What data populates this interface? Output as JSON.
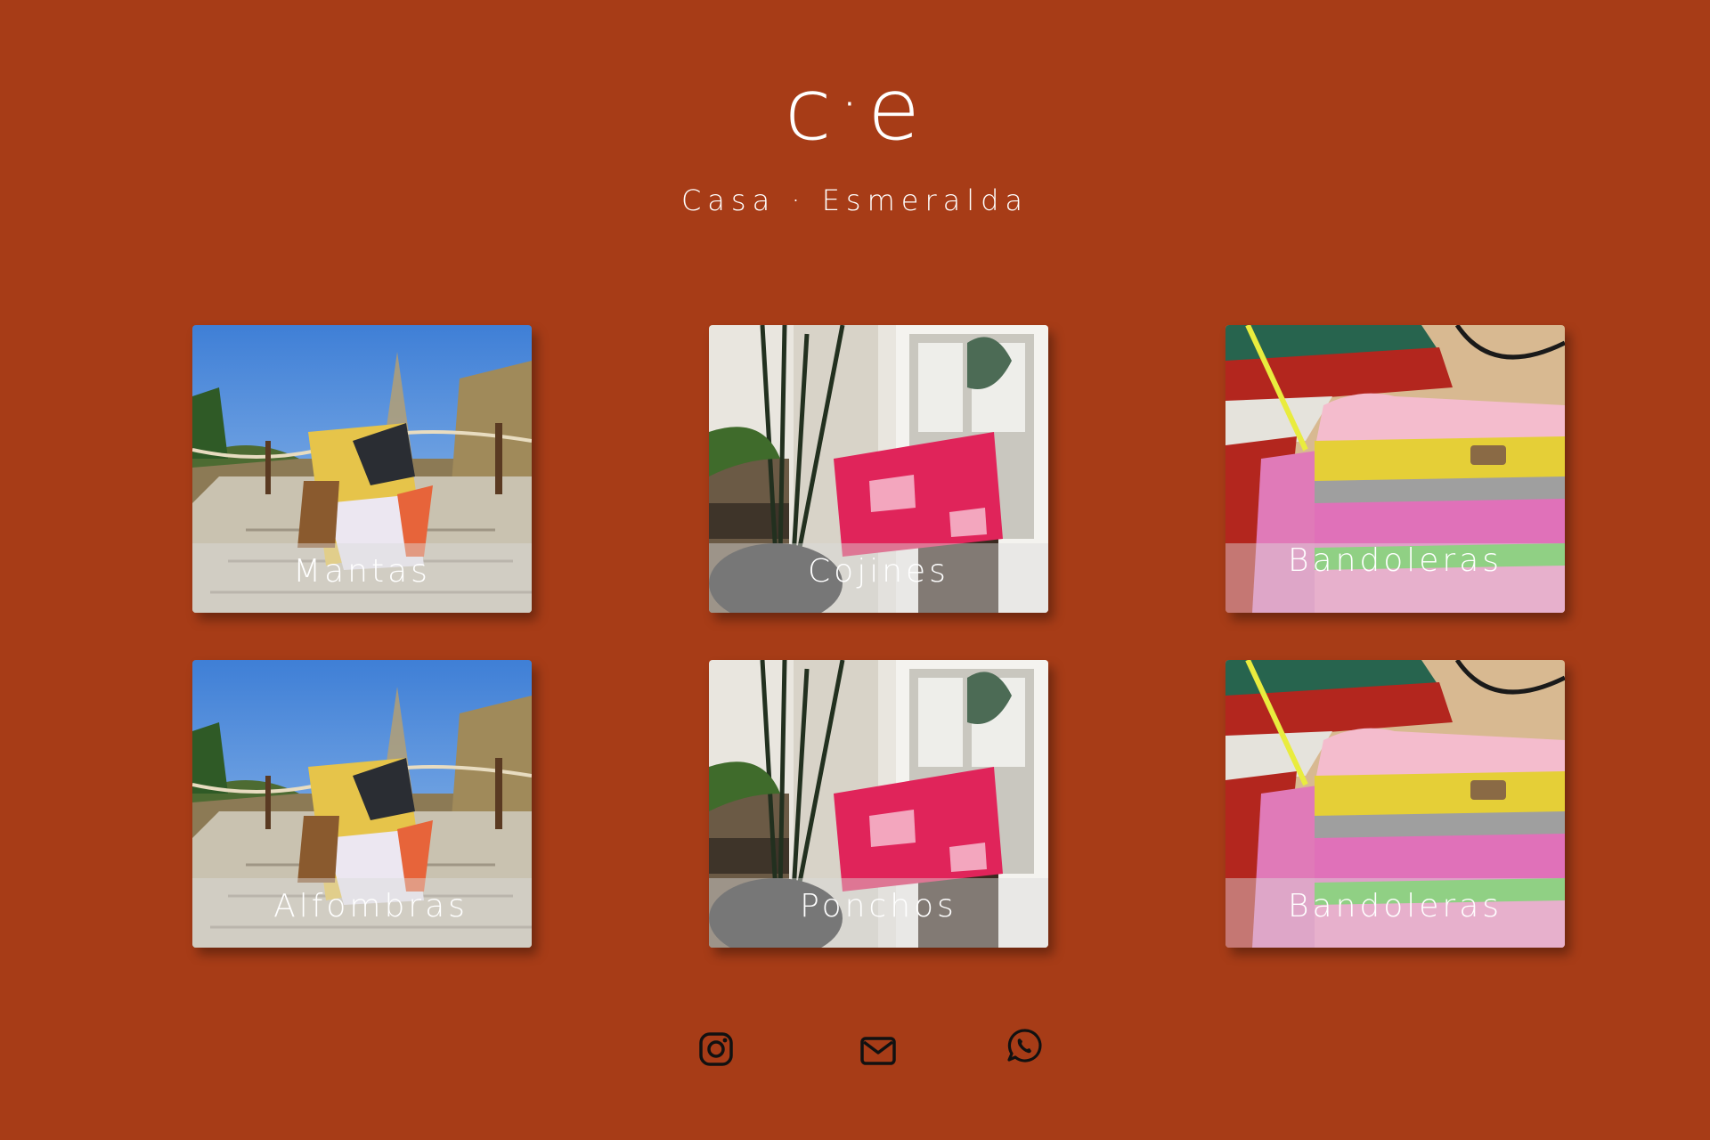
{
  "brand": {
    "logo_left": "c",
    "logo_dot": "·",
    "logo_right": "e",
    "subtitle": "Casa · Esmeralda"
  },
  "categories": [
    {
      "label": "Mantas",
      "photo": "blanket-on-chair-boardwalk"
    },
    {
      "label": "Cojines",
      "photo": "pink-cushion-on-stool"
    },
    {
      "label": "Bandoleras",
      "photo": "tufted-striped-bag"
    },
    {
      "label": "Alfombras",
      "photo": "blanket-on-chair-boardwalk"
    },
    {
      "label": "Ponchos",
      "photo": "pink-cushion-on-stool"
    },
    {
      "label": "Bandoleras",
      "photo": "tufted-striped-bag"
    }
  ],
  "social": {
    "instagram": "instagram-icon",
    "email": "envelope-icon",
    "whatsapp": "whatsapp-icon"
  },
  "colors": {
    "background": "#a73c17",
    "text": "#ffffff",
    "icon": "#111111"
  }
}
